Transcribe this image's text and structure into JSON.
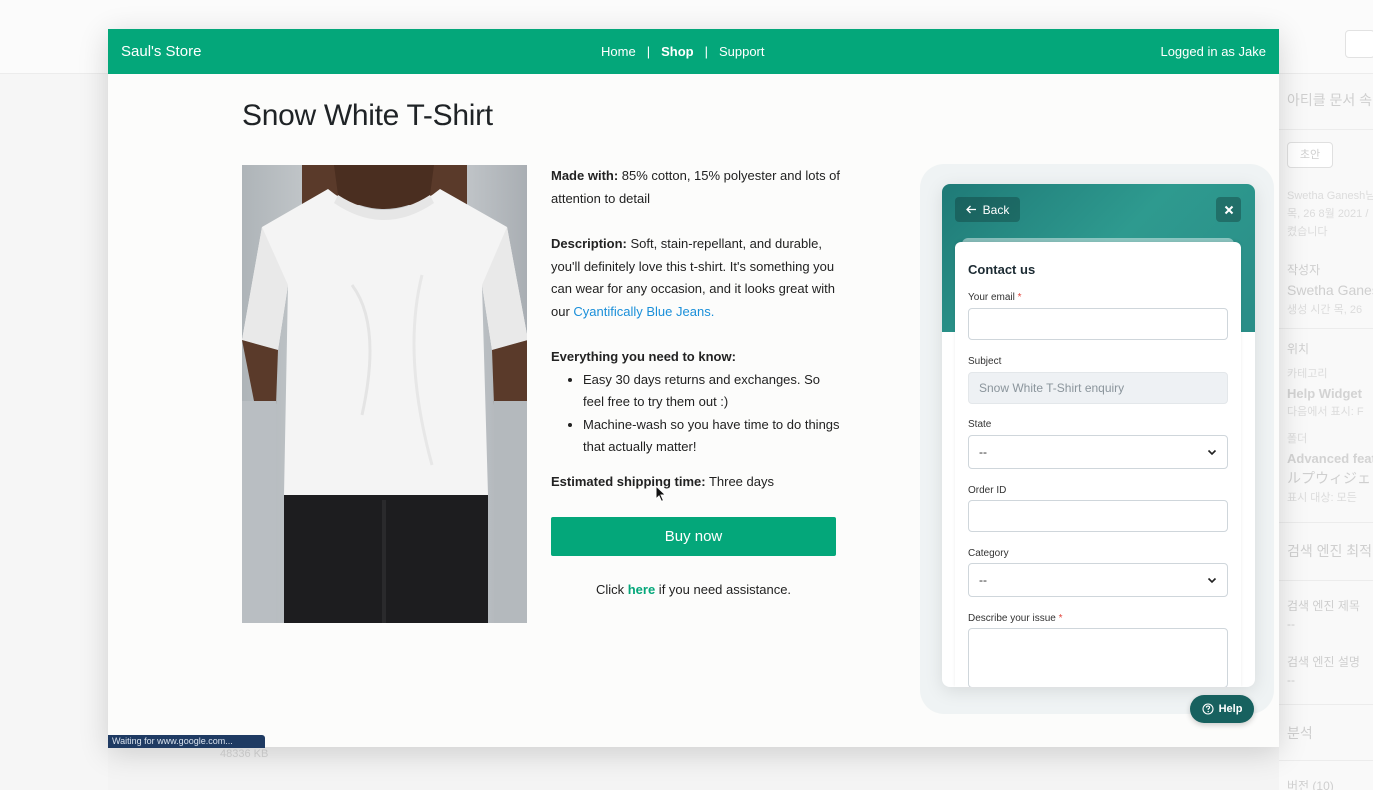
{
  "background": {
    "sidebar": {
      "article_attrs": "아티클 문서 속",
      "pill": "초안",
      "meta1": "Swetha Ganesh님",
      "meta2": "목, 26 8월 2021 /",
      "meta3": "켰습니다",
      "author_label": "작성자",
      "author_name": "Swetha Ganes",
      "created": "생성 시간 목, 26",
      "location_label": "위치",
      "category_label": "카테고리",
      "category_value": "Help Widget",
      "display_in": "다음에서 표시: F",
      "folder_label": "폴더",
      "folder_value": "Advanced feat",
      "folder_jp": "ルプウィジェ",
      "display_target": "표시 대상: 모든 ",
      "seo_title_head": "검색 엔진 최적",
      "seo_title_label": "검색 엔진 제목",
      "seo_title_value": "--",
      "seo_desc_label": "검색 엔진 설명",
      "seo_desc_value": "--",
      "analytics": "분석",
      "versions": "버전 (10)"
    },
    "bottom_text": "48336 KB"
  },
  "navbar": {
    "brand": "Saul's Store",
    "links": [
      "Home",
      "Shop",
      "Support"
    ],
    "separator": "|",
    "user": "Logged in as Jake"
  },
  "product": {
    "title": "Snow White T-Shirt",
    "made_with_label": "Made with:",
    "made_with_text": " 85% cotton, 15% polyester and lots of attention to detail",
    "description_label": "Description:",
    "description_text": " Soft, stain-repellant, and durable, you'll definitely love this t-shirt. It's something you can wear for any occasion, and it looks great with our ",
    "description_link": "Cyantifically Blue Jeans.",
    "know_heading": "Everything you need to know:",
    "know_items": [
      "Easy 30 days returns and exchanges. So feel free to try them out :)",
      "Machine-wash so you have time to do things that actually matter!"
    ],
    "shipping_label": "Estimated shipping time:",
    "shipping_text": " Three days",
    "buy_label": "Buy now",
    "assist_pre": "Click ",
    "assist_link": "here",
    "assist_post": " if you need assistance."
  },
  "widget": {
    "back_label": "Back",
    "title": "Contact us",
    "email_label": "Your email",
    "required_mark": "*",
    "subject_label": "Subject",
    "subject_value": "Snow White T-Shirt enquiry",
    "state_label": "State",
    "state_value": "--",
    "order_label": "Order ID",
    "category_label": "Category",
    "category_value": "--",
    "issue_label": "Describe your issue",
    "help_label": "Help"
  },
  "statusbar": "Waiting for www.google.com...",
  "colors": {
    "brand_green": "#04a77a",
    "widget_teal": "#2a8d87",
    "help_button": "#17615f",
    "link_blue": "#1a8fd9",
    "required_red": "#e2453c"
  }
}
